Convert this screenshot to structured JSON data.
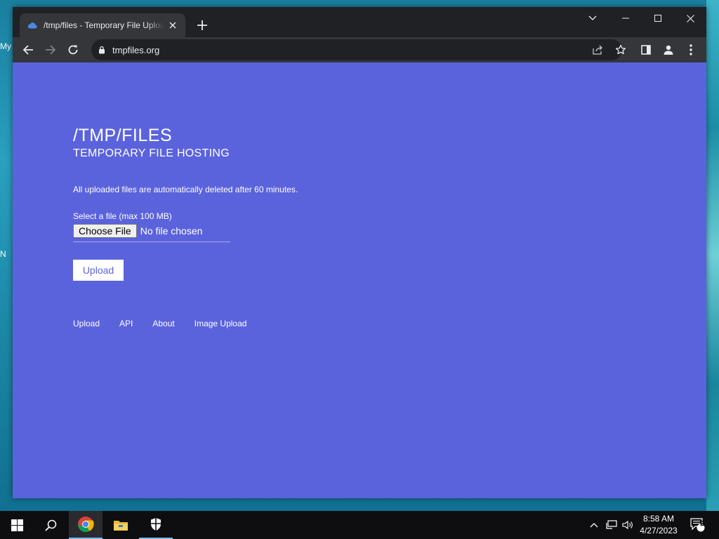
{
  "browser": {
    "tab_title": "/tmp/files - Temporary File Upload",
    "url": "tmpfiles.org"
  },
  "page": {
    "title": "/TMP/FILES",
    "subtitle": "TEMPORARY FILE HOSTING",
    "notice": "All uploaded files are automatically deleted after 60 minutes.",
    "file_label": "Select a file (max 100 MB)",
    "choose_button": "Choose File",
    "no_file": "No file chosen",
    "upload_button": "Upload",
    "footer_links": [
      "Upload",
      "API",
      "About",
      "Image Upload"
    ]
  },
  "desktop": {
    "fragment_my": "My",
    "fragment_n": "N"
  },
  "taskbar": {
    "time": "8:58 AM",
    "date": "4/27/2023",
    "notification_count": "2"
  },
  "colors": {
    "page_background": "#5b63dc",
    "browser_chrome": "#202124",
    "toolbar": "#35363a",
    "taskbar": "#0e0e10",
    "accent": "#76b9ed"
  }
}
